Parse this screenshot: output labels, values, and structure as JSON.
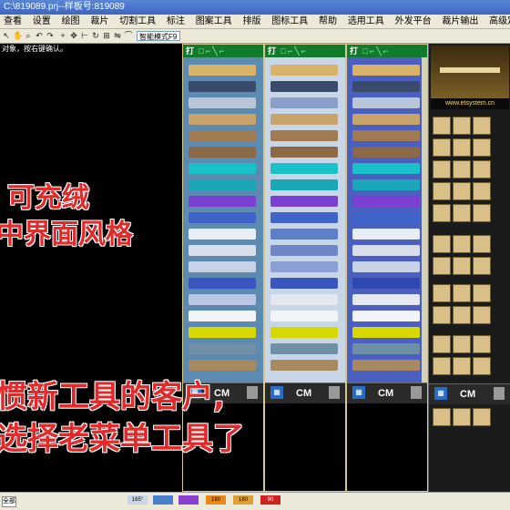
{
  "window": {
    "title": "C:\\819089.prj--样板号:819089"
  },
  "menu": [
    "查看",
    "设置",
    "绘图",
    "裁片",
    "切割工具",
    "标注",
    "图案工具",
    "排版",
    "图标工具",
    "帮助",
    "选用工具",
    "外发平台",
    "裁片输出",
    "高级定制"
  ],
  "toolbar": {
    "mode_select": "智能模式F9"
  },
  "status_hint": "对象，按右键确认。",
  "panels": [
    {
      "header_label": "打"
    },
    {
      "header_label": "打"
    },
    {
      "header_label": "打"
    }
  ],
  "panel_footer": {
    "unit": "CM"
  },
  "right_panel": {
    "url": "www.etsystem.cn"
  },
  "overlay": {
    "line1": "可充绒",
    "line2": "中界面风格",
    "line3": "惯新工具的客户,",
    "line4": "选择老菜单工具了"
  },
  "statusbar": {
    "label": "全部",
    "values": [
      "165°",
      "",
      "",
      "180",
      "180",
      "90"
    ]
  },
  "colors": {
    "header_green": "#127a2c",
    "panel1_bg": "#5d8ab0",
    "panel2_bg": "#c8d6e8",
    "panel3_bg": "#4a5fbf",
    "overlay_red": "#e32a2a"
  }
}
